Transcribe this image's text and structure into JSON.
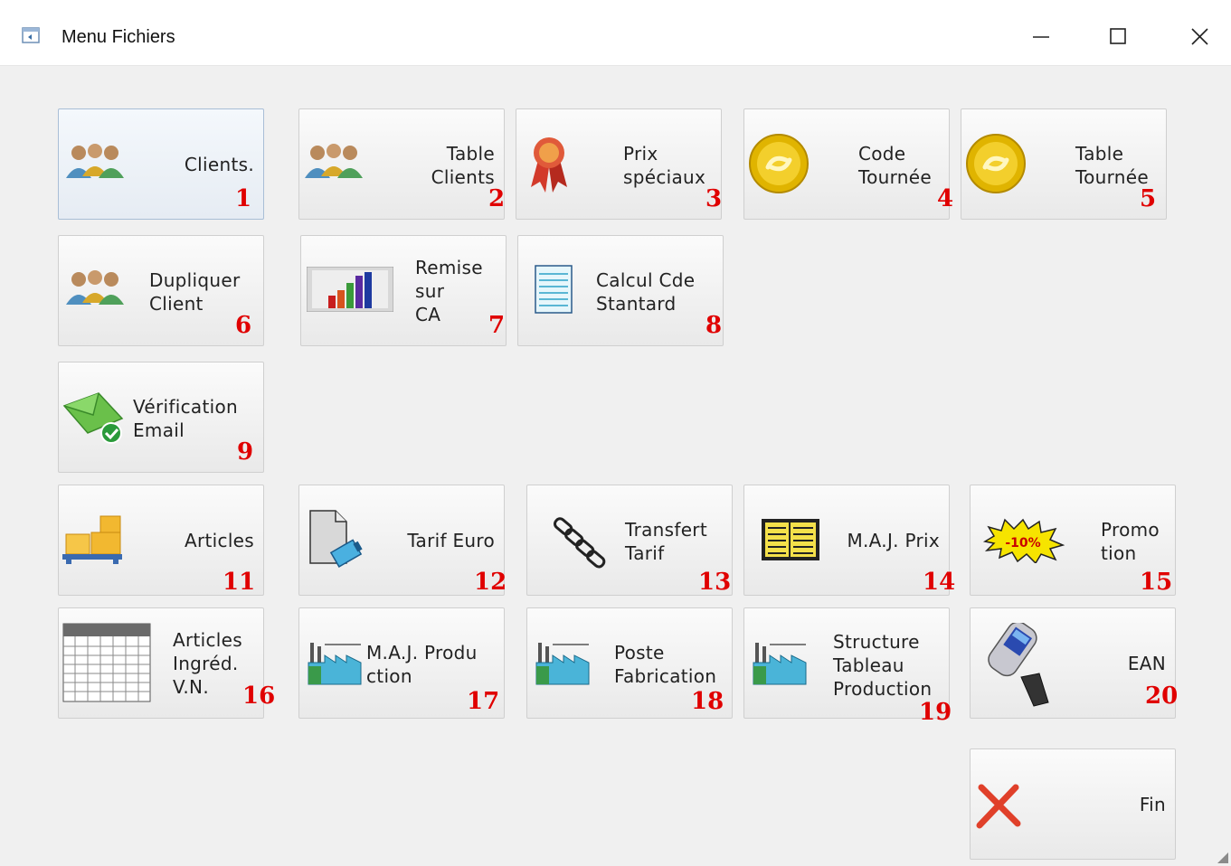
{
  "window": {
    "title": "Menu Fichiers"
  },
  "buttons": {
    "b1": {
      "label": "Clients.",
      "num": "1",
      "icon": "users-icon"
    },
    "b2": {
      "label": "Table\nClients",
      "num": "2",
      "icon": "users-icon"
    },
    "b3": {
      "label": "Prix\nspéciaux",
      "num": "3",
      "icon": "award-ribbon-icon"
    },
    "b4": {
      "label": "Code\nTournée",
      "num": "4",
      "icon": "gold-coin-icon"
    },
    "b5": {
      "label": "Table\nTournée",
      "num": "5",
      "icon": "gold-coin-icon"
    },
    "b6": {
      "label": "Dupliquer\nClient",
      "num": "6",
      "icon": "users-icon"
    },
    "b7": {
      "label": "Remise\nsur\nCA",
      "num": "7",
      "icon": "bar-chart-icon"
    },
    "b8": {
      "label": "Calcul Cde\nStantard",
      "num": "8",
      "icon": "notepad-icon"
    },
    "b9": {
      "label": "Vérification\nEmail",
      "num": "9",
      "icon": "email-check-icon"
    },
    "b11": {
      "label": "Articles",
      "num": "11",
      "icon": "boxes-icon"
    },
    "b12": {
      "label": "Tarif Euro",
      "num": "12",
      "icon": "document-euro-icon"
    },
    "b13": {
      "label": "Transfert\nTarif",
      "num": "13",
      "icon": "chain-link-icon"
    },
    "b14": {
      "label": "M.A.J. Prix",
      "num": "14",
      "icon": "price-sheet-icon"
    },
    "b15": {
      "label": "Promo\ntion",
      "num": "15",
      "icon": "promo-burst-icon",
      "burst_text": "-10%"
    },
    "b16": {
      "label": "Articles\nIngréd.\nV.N.",
      "num": "16",
      "icon": "spreadsheet-icon"
    },
    "b17": {
      "label": "M.A.J. Produ\nction",
      "num": "17",
      "icon": "factory-icon"
    },
    "b18": {
      "label": "Poste\nFabrication",
      "num": "18",
      "icon": "factory-icon"
    },
    "b19": {
      "label": "Structure\nTableau\nProduction",
      "num": "19",
      "icon": "factory-icon"
    },
    "b20": {
      "label": "EAN",
      "num": "20",
      "icon": "barcode-scanner-icon"
    },
    "fin": {
      "label": "Fin",
      "icon": "close-x-icon"
    }
  },
  "colors": {
    "number": "#e00000",
    "background": "#f0f0f0",
    "close_x": "#e0402a"
  }
}
